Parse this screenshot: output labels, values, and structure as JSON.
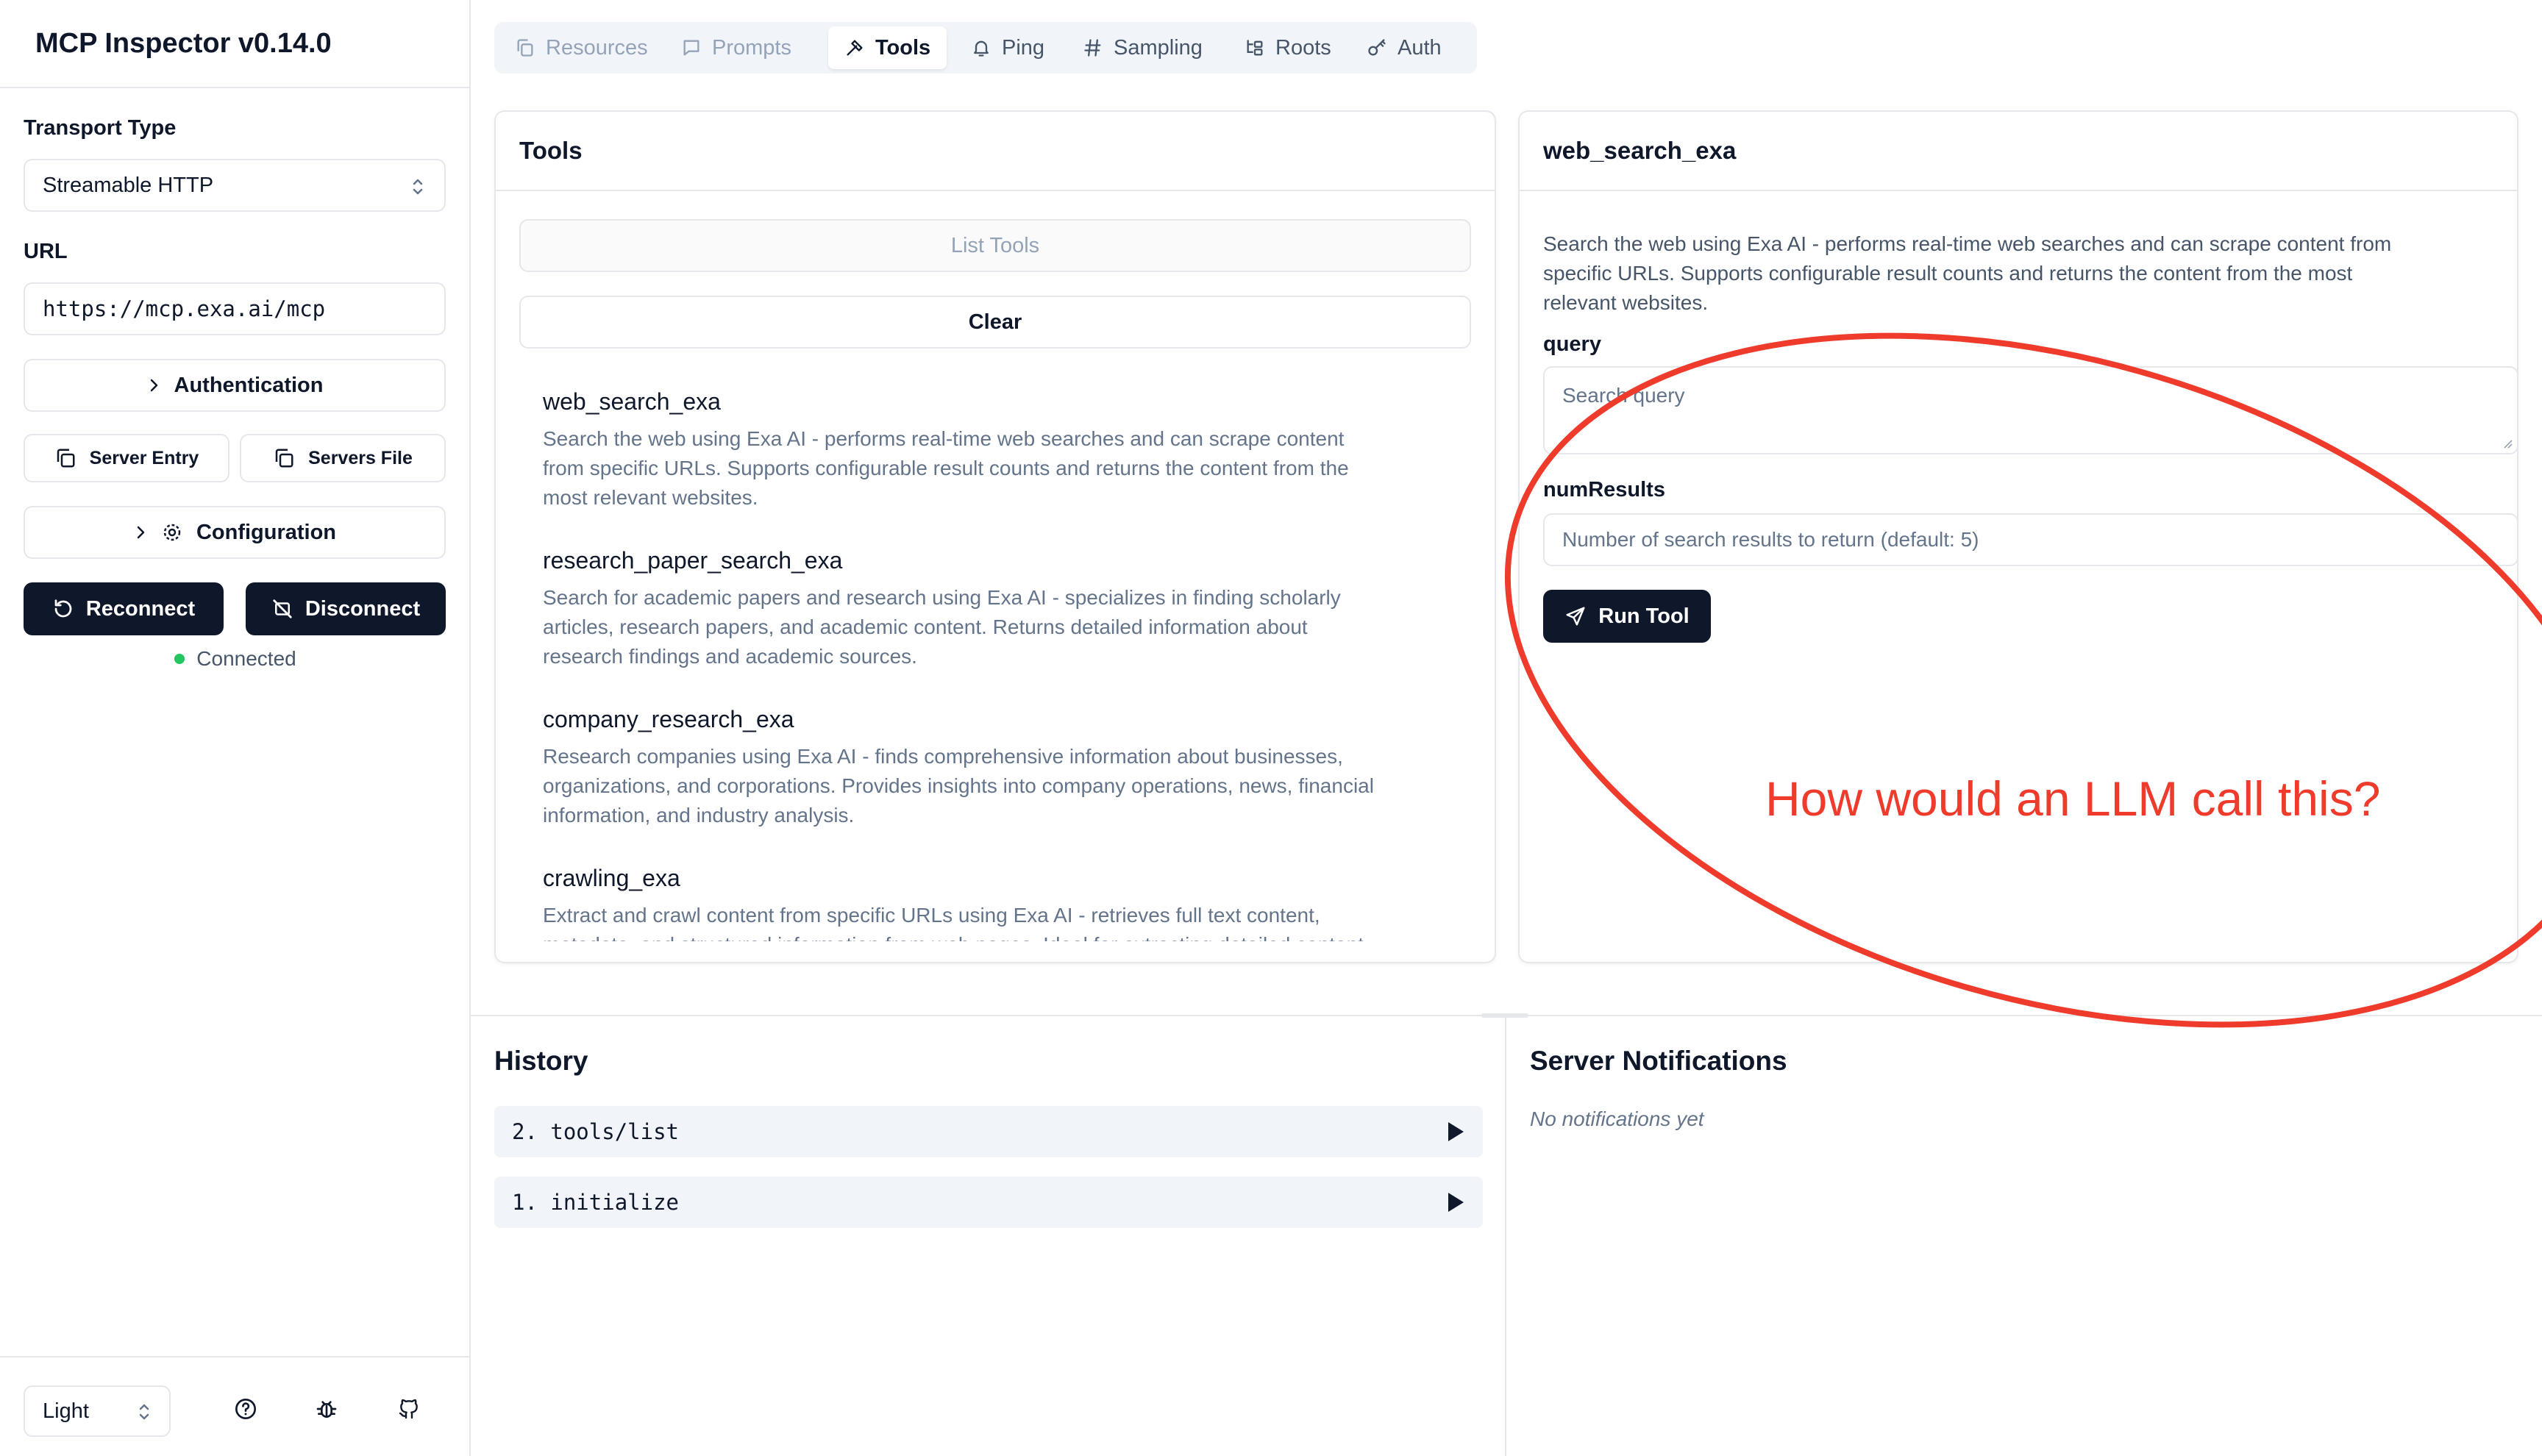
{
  "app": {
    "title": "MCP Inspector v0.14.0"
  },
  "sidebar": {
    "transport_label": "Transport Type",
    "transport_value": "Streamable HTTP",
    "url_label": "URL",
    "url_value": "https://mcp.exa.ai/mcp",
    "auth_button": "Authentication",
    "server_entry_button": "Server Entry",
    "servers_file_button": "Servers File",
    "config_button": "Configuration",
    "reconnect_button": "Reconnect",
    "disconnect_button": "Disconnect",
    "status_text": "Connected",
    "status_color": "#22c55e",
    "theme_value": "Light"
  },
  "tabs": [
    {
      "label": "Resources",
      "icon": "file-icon",
      "state": "disabled"
    },
    {
      "label": "Prompts",
      "icon": "message-icon",
      "state": "disabled"
    },
    {
      "label": "Tools",
      "icon": "hammer-icon",
      "state": "active"
    },
    {
      "label": "Ping",
      "icon": "bell-icon",
      "state": "normal"
    },
    {
      "label": "Sampling",
      "icon": "hash-icon",
      "state": "normal"
    },
    {
      "label": "Roots",
      "icon": "folder-tree-icon",
      "state": "normal"
    },
    {
      "label": "Auth",
      "icon": "key-icon",
      "state": "normal"
    }
  ],
  "tools_panel": {
    "title": "Tools",
    "list_button": "List Tools",
    "clear_button": "Clear",
    "items": [
      {
        "name": "web_search_exa",
        "desc_lines": [
          "Search the web using Exa AI - performs real-time web searches and can scrape content",
          "from specific URLs. Supports configurable result counts and returns the content from the",
          "most relevant websites."
        ]
      },
      {
        "name": "research_paper_search_exa",
        "desc_lines": [
          "Search for academic papers and research using Exa AI - specializes in finding scholarly",
          "articles, research papers, and academic content. Returns detailed information about",
          "research findings and academic sources."
        ]
      },
      {
        "name": "company_research_exa",
        "desc_lines": [
          "Research companies using Exa AI - finds comprehensive information about businesses,",
          "organizations, and corporations. Provides insights into company operations, news, financial",
          "information, and industry analysis."
        ]
      },
      {
        "name": "crawling_exa",
        "desc_lines": [
          "Extract and crawl content from specific URLs using Exa AI - retrieves full text content,",
          "metadata, and structured information from web pages. Ideal for extracting detailed content"
        ]
      }
    ]
  },
  "tool_detail": {
    "title": "web_search_exa",
    "desc_lines": [
      "Search the web using Exa AI - performs real-time web searches and can scrape content from",
      "specific URLs. Supports configurable result counts and returns the content from the most",
      "relevant websites."
    ],
    "query_label": "query",
    "query_placeholder": "Search query",
    "num_label": "numResults",
    "num_placeholder": "Number of search results to return (default: 5)",
    "run_button": "Run Tool"
  },
  "history": {
    "title": "History",
    "items": [
      {
        "index": "2.",
        "method": "tools/list"
      },
      {
        "index": "1.",
        "method": "initialize"
      }
    ]
  },
  "notifications": {
    "title": "Server Notifications",
    "empty_text": "No notifications yet"
  },
  "annotation": {
    "text": "How would an LLM call this?",
    "color": "#ef3b2c"
  }
}
